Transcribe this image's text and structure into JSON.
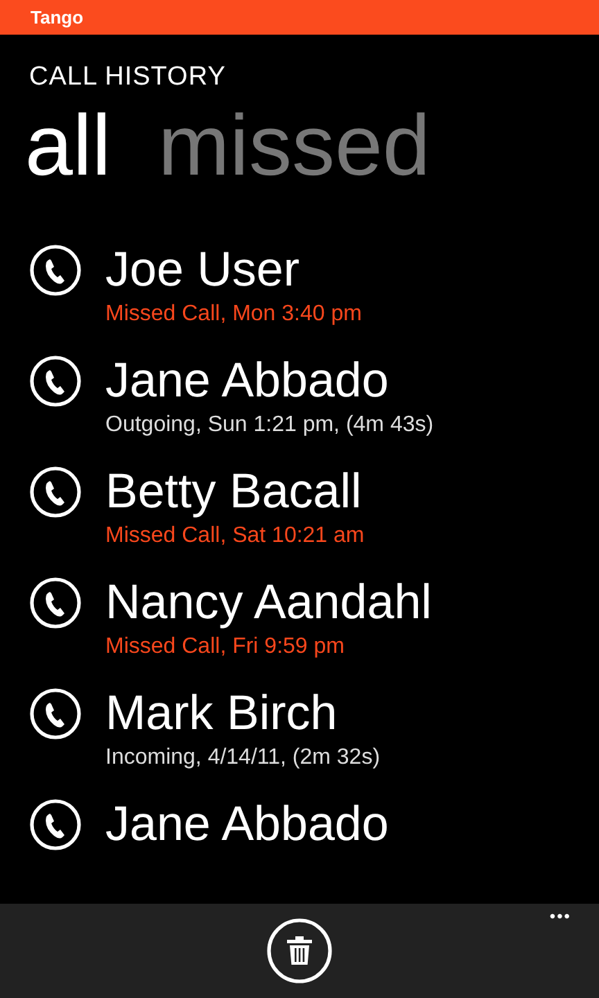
{
  "status_bar": {
    "app_name": "Tango"
  },
  "page_title": "CALL HISTORY",
  "pivot": [
    {
      "label": "all",
      "selected": true
    },
    {
      "label": "missed",
      "selected": false
    }
  ],
  "calls": [
    {
      "name": "Joe User",
      "detail": "Missed Call, Mon 3:40 pm",
      "missed": true
    },
    {
      "name": "Jane Abbado",
      "detail": "Outgoing, Sun 1:21 pm, (4m 43s)",
      "missed": false
    },
    {
      "name": "Betty Bacall",
      "detail": "Missed Call, Sat 10:21 am",
      "missed": true
    },
    {
      "name": "Nancy Aandahl",
      "detail": "Missed Call, Fri 9:59 pm",
      "missed": true
    },
    {
      "name": "Mark Birch",
      "detail": "Incoming, 4/14/11, (2m 32s)",
      "missed": false
    },
    {
      "name": "Jane Abbado"
    }
  ],
  "app_bar": {
    "buttons": [
      {
        "kind": "delete"
      }
    ],
    "more": "•••"
  }
}
